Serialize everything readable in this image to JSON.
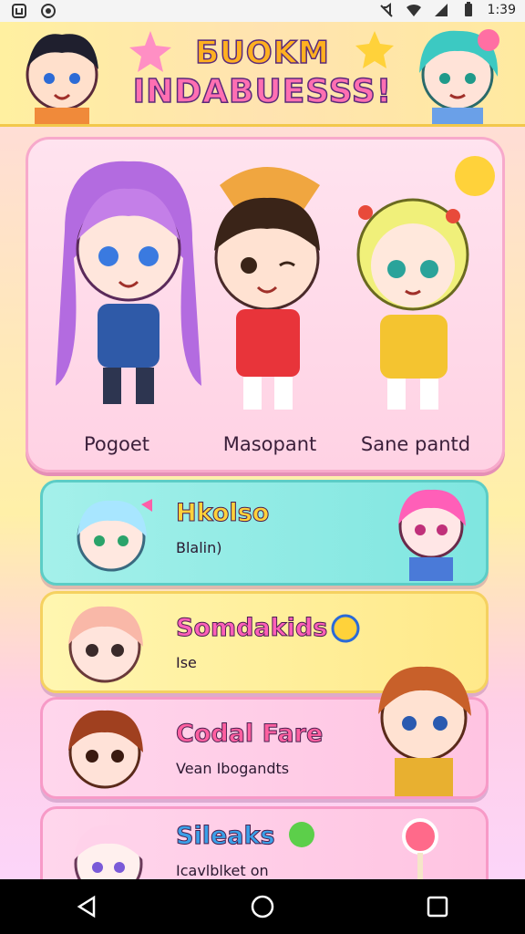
{
  "status_bar": {
    "time": "1:39"
  },
  "header": {
    "title_line1": "БUOKM",
    "title_line2": "INDABUESSS!"
  },
  "featured": {
    "characters": [
      {
        "label": "Pogoet"
      },
      {
        "label": "Masopant"
      },
      {
        "label": "Sane pantd"
      }
    ]
  },
  "list": [
    {
      "title": "Hkolso",
      "subtitle": "Blalin)"
    },
    {
      "title": "Somdakids",
      "subtitle": "Ise"
    },
    {
      "title": "Codal Fare",
      "subtitle": "Vean Ibogandts"
    },
    {
      "title": "Sileaks",
      "subtitle": "Icavlblket on"
    }
  ],
  "colors": {
    "accent_pink": "#ff6fb2",
    "accent_yellow": "#ffb020",
    "teal_card": "#7fe6e0"
  },
  "icons": [
    "status-app-icon",
    "status-sync-icon",
    "mute-icon",
    "wifi-icon",
    "signal-icon",
    "battery-icon",
    "back-icon",
    "home-icon",
    "recents-icon"
  ]
}
